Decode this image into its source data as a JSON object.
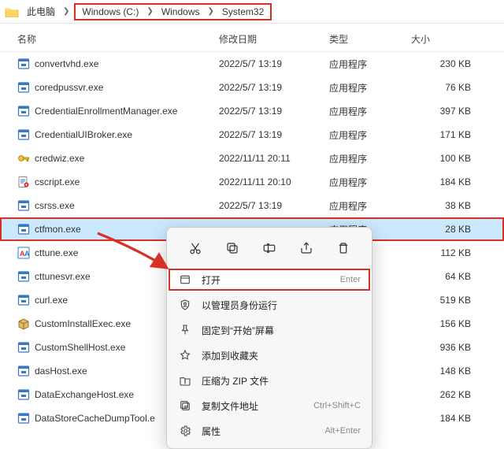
{
  "breadcrumb": {
    "root": "此电脑",
    "boxed": [
      "Windows (C:)",
      "Windows",
      "System32"
    ]
  },
  "columns": {
    "name": "名称",
    "date": "修改日期",
    "type": "类型",
    "size": "大小"
  },
  "type_label": "应用程序",
  "files": [
    {
      "name": "convertvhd.exe",
      "date": "2022/5/7 13:19",
      "size": "230 KB",
      "icon": "exe"
    },
    {
      "name": "coredpussvr.exe",
      "date": "2022/5/7 13:19",
      "size": "76 KB",
      "icon": "exe"
    },
    {
      "name": "CredentialEnrollmentManager.exe",
      "date": "2022/5/7 13:19",
      "size": "397 KB",
      "icon": "exe"
    },
    {
      "name": "CredentialUIBroker.exe",
      "date": "2022/5/7 13:19",
      "size": "171 KB",
      "icon": "exe"
    },
    {
      "name": "credwiz.exe",
      "date": "2022/11/11 20:11",
      "size": "100 KB",
      "icon": "key"
    },
    {
      "name": "cscript.exe",
      "date": "2022/11/11 20:10",
      "size": "184 KB",
      "icon": "script"
    },
    {
      "name": "csrss.exe",
      "date": "2022/5/7 13:19",
      "size": "38 KB",
      "icon": "exe"
    },
    {
      "name": "ctfmon.exe",
      "date": "",
      "size": "28 KB",
      "icon": "exe",
      "selected": true
    },
    {
      "name": "cttune.exe",
      "date": "",
      "size": "112 KB",
      "icon": "cttune"
    },
    {
      "name": "cttunesvr.exe",
      "date": "",
      "size": "64 KB",
      "icon": "exe"
    },
    {
      "name": "curl.exe",
      "date": "",
      "size": "519 KB",
      "icon": "exe"
    },
    {
      "name": "CustomInstallExec.exe",
      "date": "",
      "size": "156 KB",
      "icon": "box"
    },
    {
      "name": "CustomShellHost.exe",
      "date": "",
      "size": "936 KB",
      "icon": "exe"
    },
    {
      "name": "dasHost.exe",
      "date": "",
      "size": "148 KB",
      "icon": "exe"
    },
    {
      "name": "DataExchangeHost.exe",
      "date": "",
      "size": "262 KB",
      "icon": "exe"
    },
    {
      "name": "DataStoreCacheDumpTool.e",
      "date": "",
      "size": "184 KB",
      "icon": "exe"
    }
  ],
  "context_menu": {
    "top_icons": [
      "cut",
      "copy",
      "rename",
      "share",
      "delete"
    ],
    "items": [
      {
        "icon": "open",
        "label": "打开",
        "shortcut": "Enter",
        "hl": true
      },
      {
        "icon": "admin",
        "label": "以管理员身份运行",
        "shortcut": ""
      },
      {
        "icon": "pin",
        "label": "固定到“开始”屏幕",
        "shortcut": ""
      },
      {
        "icon": "fav",
        "label": "添加到收藏夹",
        "shortcut": ""
      },
      {
        "icon": "zip",
        "label": "压缩为 ZIP 文件",
        "shortcut": ""
      },
      {
        "icon": "copypath",
        "label": "复制文件地址",
        "shortcut": "Ctrl+Shift+C"
      },
      {
        "icon": "props",
        "label": "属性",
        "shortcut": "Alt+Enter"
      }
    ]
  },
  "colors": {
    "highlight_box": "#d93025",
    "selection": "#cce8ff"
  }
}
